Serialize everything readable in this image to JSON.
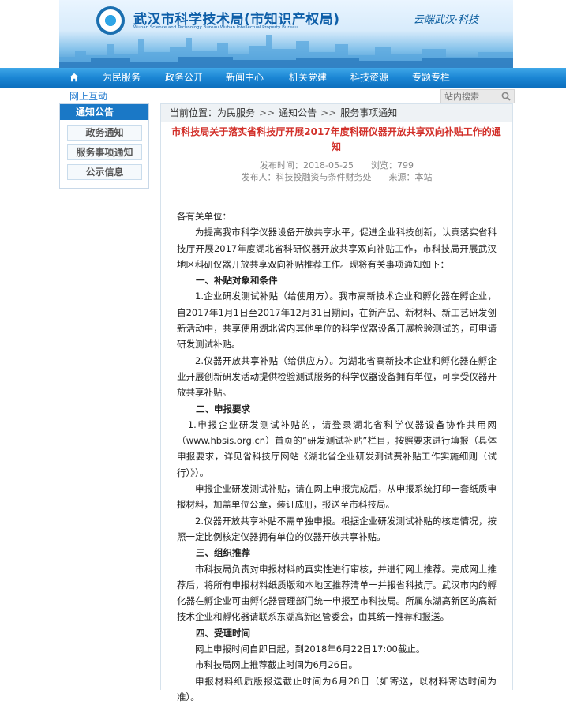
{
  "header": {
    "title": "武汉市科学技术局(市知识产权局)",
    "subtitle": "Wuhan Science and Technology Bureau Wuhan Intellectual Property Bureau",
    "slogan": "云端武汉·科技"
  },
  "nav": {
    "items": [
      "为民服务",
      "政务公开",
      "新闻中心",
      "机关党建",
      "科技资源",
      "专题专栏"
    ],
    "secondary": "网上互动"
  },
  "search": {
    "placeholder": "站内搜索"
  },
  "sidebar": {
    "heading": "通知公告",
    "items": [
      "政务通知",
      "服务事项通知",
      "公示信息"
    ]
  },
  "breadcrumb": {
    "label": "当前位置：",
    "items": [
      "为民服务",
      "通知公告",
      "服务事项通知"
    ],
    "separator": ">>"
  },
  "article": {
    "title": "市科技局关于落实省科技厅开展2017年度科研仪器开放共享双向补贴工作的通知",
    "meta_line1": "发布时间：2018-05-25　　浏览：799",
    "meta_line2": "发布人：科技投融资与条件财务处　　来源：本站",
    "paragraphs": [
      "各有关单位：",
      "为提高我市科学仪器设备开放共享水平，促进企业科技创新，认真落实省科技厅开展2017年度湖北省科研仪器开放共享双向补贴工作，市科技局开展武汉地区科研仪器开放共享双向补贴推荐工作。现将有关事项通知如下：",
      "一、补贴对象和条件",
      "1.企业研发测试补贴（给使用方）。我市高新技术企业和孵化器在孵企业，自2017年1月1日至2017年12月31日期间，在新产品、新材料、新工艺研发创新活动中，共享使用湖北省内其他单位的科学仪器设备开展检验测试的，可申请研发测试补贴。",
      "2.仪器开放共享补贴（给供应方）。为湖北省高新技术企业和孵化器在孵企业开展创新研发活动提供检验测试服务的科学仪器设备拥有单位，可享受仪器开放共享补贴。",
      "二、申报要求",
      "1.申报企业研发测试补贴的，请登录湖北省科学仪器设备协作共用网（www.hbsis.org.cn）首页的“研发测试补贴”栏目，按照要求进行填报（具体申报要求，详见省科技厅网站《湖北省企业研发测试费补贴工作实施细则（试行）》）。",
      "申报企业研发测试补贴，请在网上申报完成后，从申报系统打印一套纸质申报材料，加盖单位公章，装订成册，报送至市科技局。",
      "2.仪器开放共享补贴不需单独申报。根据企业研发测试补贴的核定情况，按照一定比例核定仪器拥有单位的仪器开放共享补贴。",
      "三、组织推荐",
      "市科技局负责对申报材料的真实性进行审核，并进行网上推荐。完成网上推荐后，将所有申报材料纸质版和本地区推荐清单一并报省科技厅。武汉市内的孵化器在孵企业可由孵化器管理部门统一申报至市科技局。所属东湖高新区的高新技术企业和孵化器请联系东湖高新区管委会，由其统一推荐和报送。",
      "四、受理时间",
      "网上申报时间自即日起，到2018年6月22日17:00截止。",
      "市科技局网上推荐截止时间为6月26日。",
      "申报材料纸质版报送截止时间为6月28日（如寄送，以材料寄达时间为准）。"
    ]
  },
  "colors": {
    "nav_blue": "#1b86d4",
    "title_red": "#d2302a",
    "sidebar_blue": "#1a78c6"
  }
}
